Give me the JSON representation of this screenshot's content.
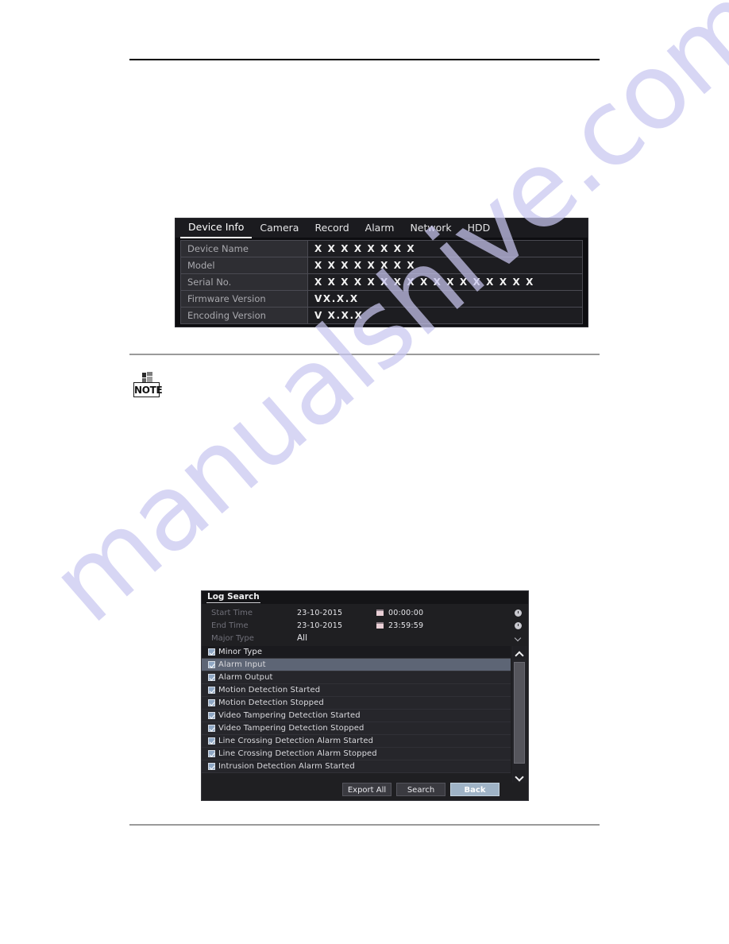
{
  "watermark": {
    "text": "manualshive.com"
  },
  "note": {
    "label": "NOTE",
    "icon": "note-badge-icon"
  },
  "device_info": {
    "tabs": [
      {
        "label": "Device Info",
        "active": true
      },
      {
        "label": "Camera",
        "active": false
      },
      {
        "label": "Record",
        "active": false
      },
      {
        "label": "Alarm",
        "active": false
      },
      {
        "label": "Network",
        "active": false
      },
      {
        "label": "HDD",
        "active": false
      }
    ],
    "rows": [
      {
        "label": "Device Name",
        "value": "X X X X X X X X"
      },
      {
        "label": "Model",
        "value": "X X X X X X X X"
      },
      {
        "label": "Serial No.",
        "value": "X X X X X X X X X X X X X X X X X"
      },
      {
        "label": "Firmware Version",
        "value": "VX.X.X"
      },
      {
        "label": "Encoding Version",
        "value": "V X.X.X"
      }
    ]
  },
  "log_search": {
    "title": "Log Search",
    "fields": {
      "start_time_label": "Start Time",
      "start_date_value": "23-10-2015",
      "start_clock_value": "00:00:00",
      "end_time_label": "End Time",
      "end_date_value": "23-10-2015",
      "end_clock_value": "23:59:59",
      "major_type_label": "Major Type",
      "major_type_value": "All"
    },
    "minor_type_header": "Minor Type",
    "minor_types": [
      {
        "label": "Alarm Input",
        "checked": true,
        "selected": true
      },
      {
        "label": "Alarm Output",
        "checked": true,
        "selected": false
      },
      {
        "label": "Motion Detection Started",
        "checked": true,
        "selected": false
      },
      {
        "label": "Motion Detection Stopped",
        "checked": true,
        "selected": false
      },
      {
        "label": "Video Tampering Detection Started",
        "checked": true,
        "selected": false
      },
      {
        "label": "Video Tampering Detection Stopped",
        "checked": true,
        "selected": false
      },
      {
        "label": "Line Crossing Detection Alarm Started",
        "checked": true,
        "selected": false
      },
      {
        "label": "Line Crossing Detection Alarm Stopped",
        "checked": true,
        "selected": false
      },
      {
        "label": "Intrusion Detection Alarm Started",
        "checked": true,
        "selected": false
      }
    ],
    "buttons": {
      "export_all": "Export All",
      "search": "Search",
      "back": "Back"
    }
  },
  "colors": {
    "panel_bg": "#0d0d10",
    "dialog_bg": "#1f1f22",
    "row_label_bg": "#2e2e33",
    "selected_row": "#5d6575",
    "primary_button": "#9fb3c6",
    "watermark": "#c9c7f0"
  }
}
